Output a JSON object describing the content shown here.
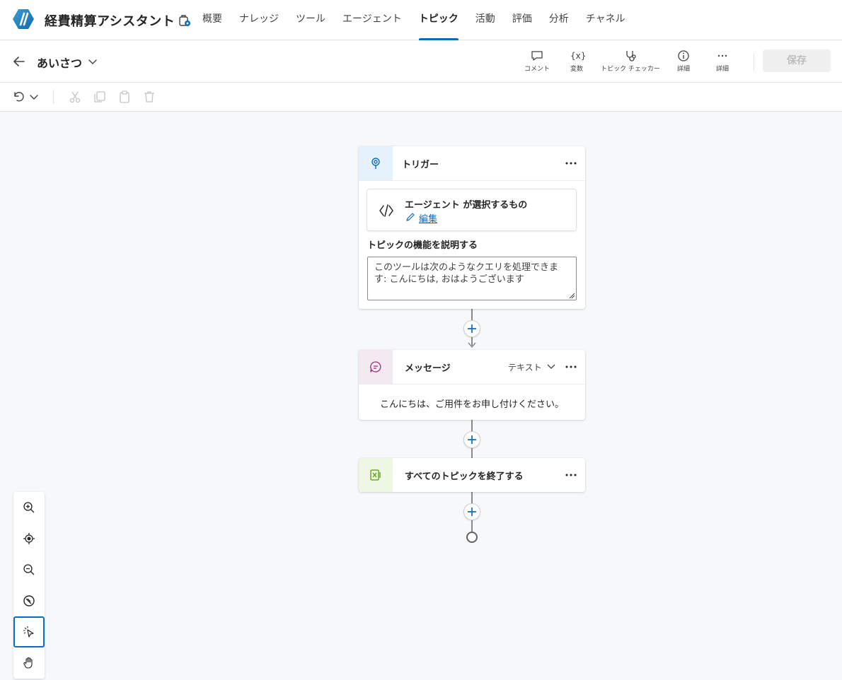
{
  "app": {
    "title": "経費精算アシスタント",
    "accent_color": "#0f6cbd",
    "logo_icon": "agent-logo-icon"
  },
  "nav": {
    "items": [
      {
        "label": "概要",
        "active": false
      },
      {
        "label": "ナレッジ",
        "active": false
      },
      {
        "label": "ツール",
        "active": false
      },
      {
        "label": "エージェント",
        "active": false
      },
      {
        "label": "トピック",
        "active": true
      },
      {
        "label": "活動",
        "active": false
      },
      {
        "label": "評価",
        "active": false
      },
      {
        "label": "分析",
        "active": false
      },
      {
        "label": "チャネル",
        "active": false
      }
    ]
  },
  "topic": {
    "name": "あいさつ"
  },
  "toolbar": {
    "comment_label": "コメント",
    "variables_label": "変数",
    "variables_icon_text": "{x}",
    "checker_label": "トピック チェッカー",
    "details_label": "詳細",
    "more_label": "詳細",
    "save_label": "保存"
  },
  "trigger": {
    "title": "トリガー",
    "card_title": "エージェント が選択するもの",
    "edit_label": "編集",
    "describe_label": "トピックの機能を説明する",
    "description": "このツールは次のようなクエリを処理できます: こんにちは, おはようございます"
  },
  "message": {
    "title": "メッセージ",
    "type_label": "テキスト",
    "text": "こんにちは、ご用件をお申し付けください。"
  },
  "end": {
    "title": "すべてのトピックを終了する"
  },
  "colors": {
    "trigger_icon_bg": "#e6f2fb",
    "message_icon_bg": "#f3eaf1",
    "end_icon_bg": "#eef6e4"
  }
}
